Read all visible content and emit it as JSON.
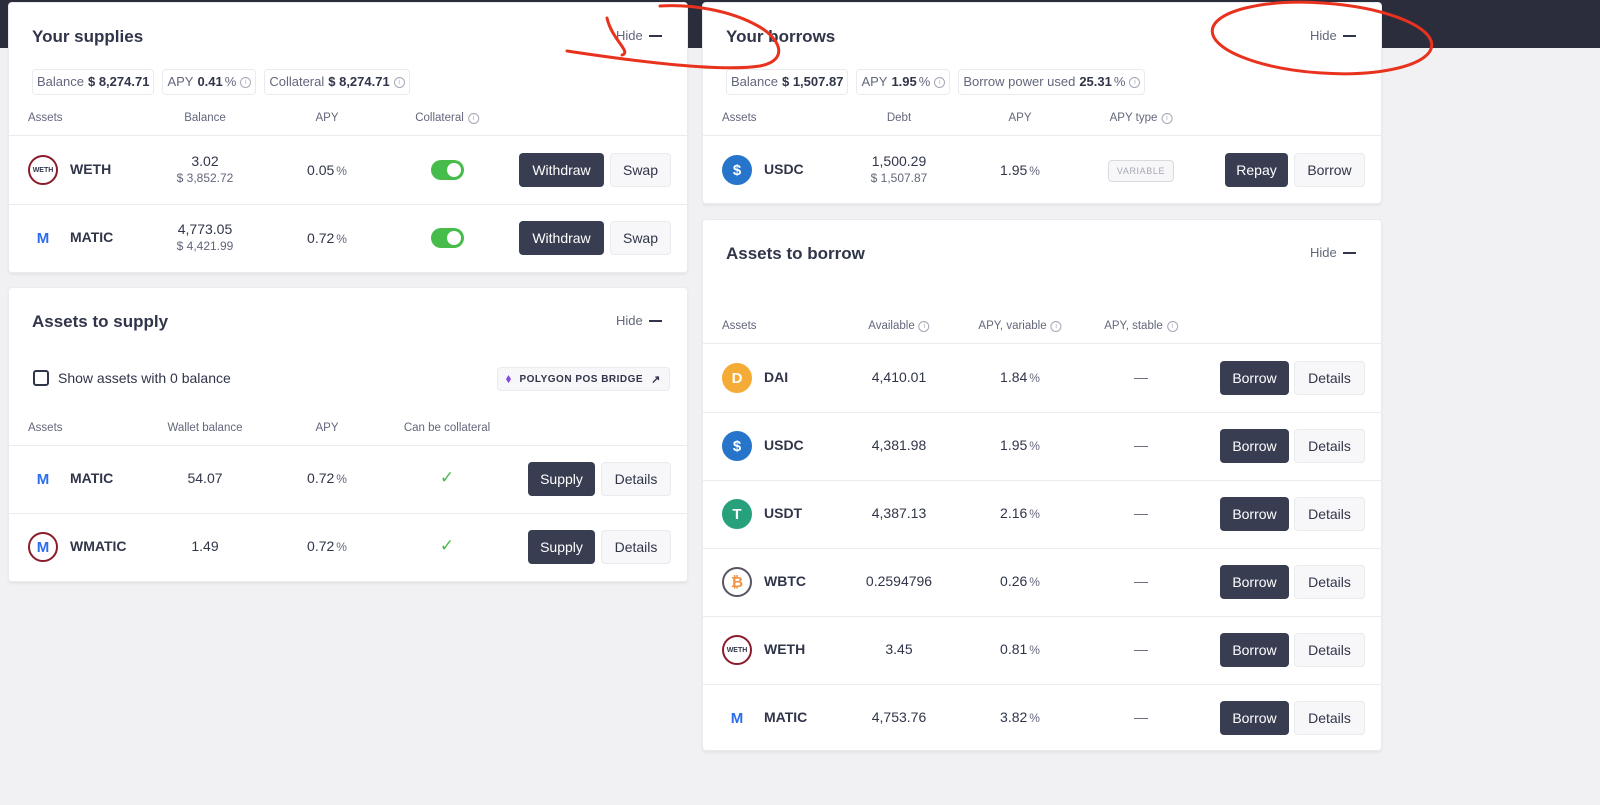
{
  "supplies": {
    "title": "Your supplies",
    "hide_label": "Hide",
    "chips": [
      {
        "label": "Balance",
        "value": "$ 8,274.71",
        "suffix": ""
      },
      {
        "label": "APY",
        "value": "0.41",
        "suffix": "%"
      },
      {
        "label": "Collateral",
        "value": "$ 8,274.71",
        "suffix": ""
      }
    ],
    "headers": {
      "assets": "Assets",
      "balance": "Balance",
      "apy": "APY",
      "collateral": "Collateral"
    },
    "rows": [
      {
        "asset": "WETH",
        "balance": "3.02",
        "usd": "$ 3,852.72",
        "apy": "0.05",
        "collateral": true,
        "btn1": "Withdraw",
        "btn2": "Swap"
      },
      {
        "asset": "MATIC",
        "balance": "4,773.05",
        "usd": "$ 4,421.99",
        "apy": "0.72",
        "collateral": true,
        "btn1": "Withdraw",
        "btn2": "Swap"
      }
    ]
  },
  "to_supply": {
    "title": "Assets to supply",
    "hide_label": "Hide",
    "show_zero_label": "Show assets with 0 balance",
    "bridge_label": "POLYGON POS BRIDGE",
    "headers": {
      "assets": "Assets",
      "wallet": "Wallet balance",
      "apy": "APY",
      "collateral": "Can be collateral"
    },
    "rows": [
      {
        "asset": "MATIC",
        "wallet": "54.07",
        "apy": "0.72",
        "btn1": "Supply",
        "btn2": "Details"
      },
      {
        "asset": "WMATIC",
        "wallet": "1.49",
        "apy": "0.72",
        "btn1": "Supply",
        "btn2": "Details"
      }
    ]
  },
  "borrows": {
    "title": "Your borrows",
    "hide_label": "Hide",
    "chips": [
      {
        "label": "Balance",
        "value": "$ 1,507.87",
        "suffix": ""
      },
      {
        "label": "APY",
        "value": "1.95",
        "suffix": "%"
      },
      {
        "label": "Borrow power used",
        "value": "25.31",
        "suffix": "%"
      }
    ],
    "headers": {
      "assets": "Assets",
      "debt": "Debt",
      "apy": "APY",
      "apy_type": "APY type"
    },
    "rows": [
      {
        "asset": "USDC",
        "debt": "1,500.29",
        "usd": "$ 1,507.87",
        "apy": "1.95",
        "apy_type": "VARIABLE",
        "btn1": "Repay",
        "btn2": "Borrow"
      }
    ]
  },
  "to_borrow": {
    "title": "Assets to borrow",
    "hide_label": "Hide",
    "headers": {
      "assets": "Assets",
      "available": "Available",
      "apy_variable": "APY, variable",
      "apy_stable": "APY, stable"
    },
    "rows": [
      {
        "asset": "DAI",
        "available": "4,410.01",
        "apy": "1.84",
        "stable": "—",
        "btn1": "Borrow",
        "btn2": "Details"
      },
      {
        "asset": "USDC",
        "available": "4,381.98",
        "apy": "1.95",
        "stable": "—",
        "btn1": "Borrow",
        "btn2": "Details"
      },
      {
        "asset": "USDT",
        "available": "4,387.13",
        "apy": "2.16",
        "stable": "—",
        "btn1": "Borrow",
        "btn2": "Details"
      },
      {
        "asset": "WBTC",
        "available": "0.2594796",
        "apy": "0.26",
        "stable": "—",
        "btn1": "Borrow",
        "btn2": "Details"
      },
      {
        "asset": "WETH",
        "available": "3.45",
        "apy": "0.81",
        "stable": "—",
        "btn1": "Borrow",
        "btn2": "Details"
      },
      {
        "asset": "MATIC",
        "available": "4,753.76",
        "apy": "3.82",
        "stable": "—",
        "btn1": "Borrow",
        "btn2": "Details"
      }
    ]
  },
  "icons": {
    "WETH": {
      "text": "WETH",
      "bg": "#ffffff",
      "fg": "#303549",
      "ring": "#8a1c2b"
    },
    "MATIC": {
      "text": "M",
      "bg": "#ffffff",
      "fg": "#2b6def",
      "ring": "#ffffff"
    },
    "WMATIC": {
      "text": "M",
      "bg": "#ffffff",
      "fg": "#2b6def",
      "ring": "#8a1c2b"
    },
    "USDC": {
      "text": "$",
      "bg": "#2775ca",
      "fg": "#ffffff",
      "ring": "#2775ca"
    },
    "DAI": {
      "text": "D",
      "bg": "#f5ac37",
      "fg": "#ffffff",
      "ring": "#f5ac37"
    },
    "USDT": {
      "text": "T",
      "bg": "#26a17b",
      "fg": "#ffffff",
      "ring": "#26a17b"
    },
    "WBTC": {
      "text": "₿",
      "bg": "#ffffff",
      "fg": "#f09242",
      "ring": "#5a5564"
    }
  },
  "colors": {
    "annotation": "#e8321e",
    "toggle_on": "#46bc4b",
    "button_dark": "#383d51",
    "topbar": "#2b2d3c"
  }
}
